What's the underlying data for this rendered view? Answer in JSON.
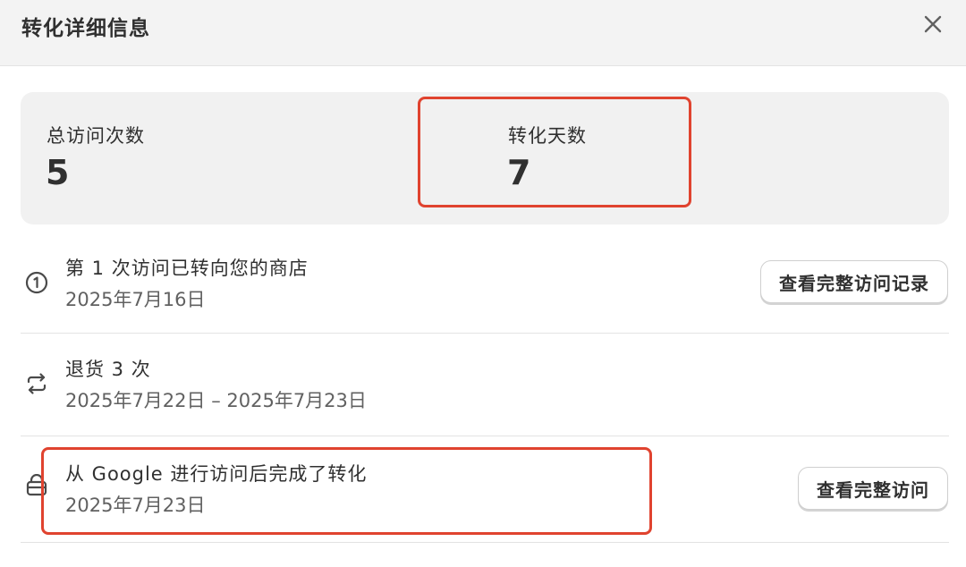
{
  "header": {
    "title": "转化详细信息",
    "close_icon": "close-icon"
  },
  "stats": {
    "visits_label": "总访问次数",
    "visits_value": "5",
    "days_label": "转化天数",
    "days_value": "7"
  },
  "timeline": [
    {
      "icon": "numbered-circle-icon",
      "title": "第 1 次访问已转向您的商店",
      "date": "2025年7月16日",
      "button": "查看完整访问记录"
    },
    {
      "icon": "return-arrows-icon",
      "title": "退货 3 次",
      "date": "2025年7月22日 – 2025年7月23日"
    },
    {
      "icon": "cart-icon",
      "title": "从 Google 进行访问后完成了转化",
      "date": "2025年7月23日",
      "button": "查看完整访问"
    }
  ],
  "colors": {
    "highlight": "#e0432f",
    "header_bg": "#f3f3f3",
    "card_bg": "#f1f1f1"
  }
}
